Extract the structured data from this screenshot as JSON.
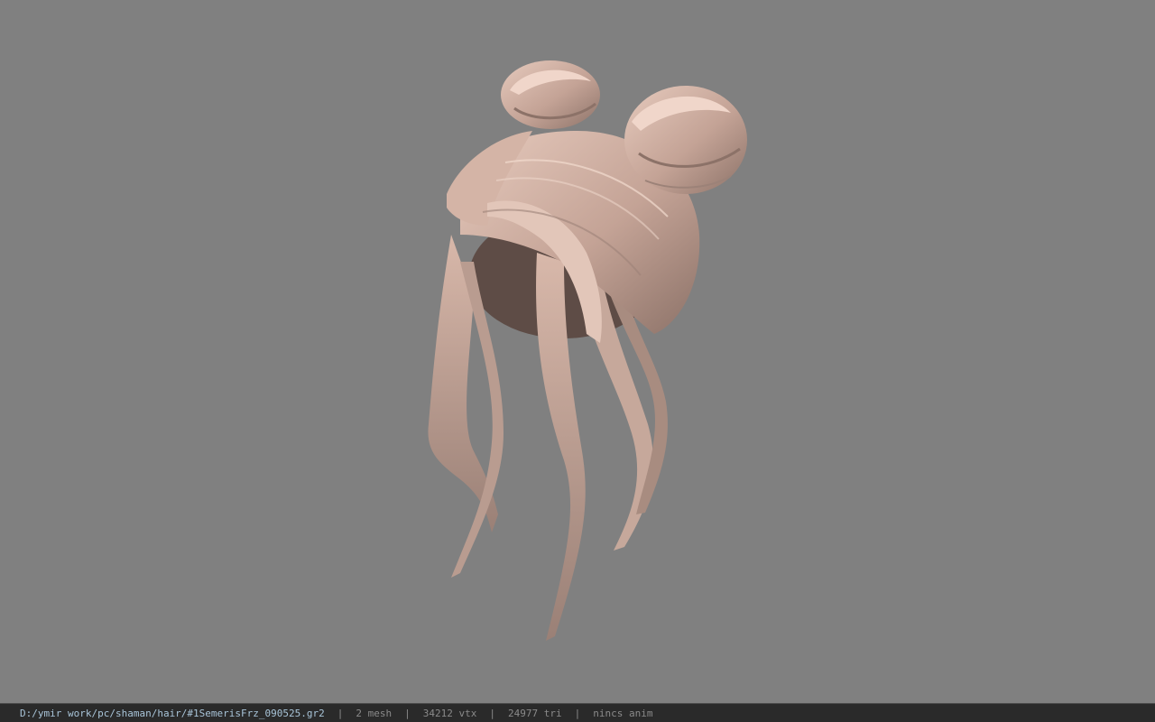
{
  "viewport": {
    "model_name": "hair-model",
    "colors": {
      "background": "#808080",
      "hair_light": "#e0c4b8",
      "hair_mid": "#b89a8e",
      "hair_dark": "#6e5a52"
    }
  },
  "status_bar": {
    "file_path": "D:/ymir work/pc/shaman/hair/#1SemerisFrz_090525.gr2",
    "separator": "|",
    "mesh_count": "2 mesh",
    "vertex_count": "34212 vtx",
    "triangle_count": "24977 tri",
    "anim_status": "nincs anim"
  }
}
